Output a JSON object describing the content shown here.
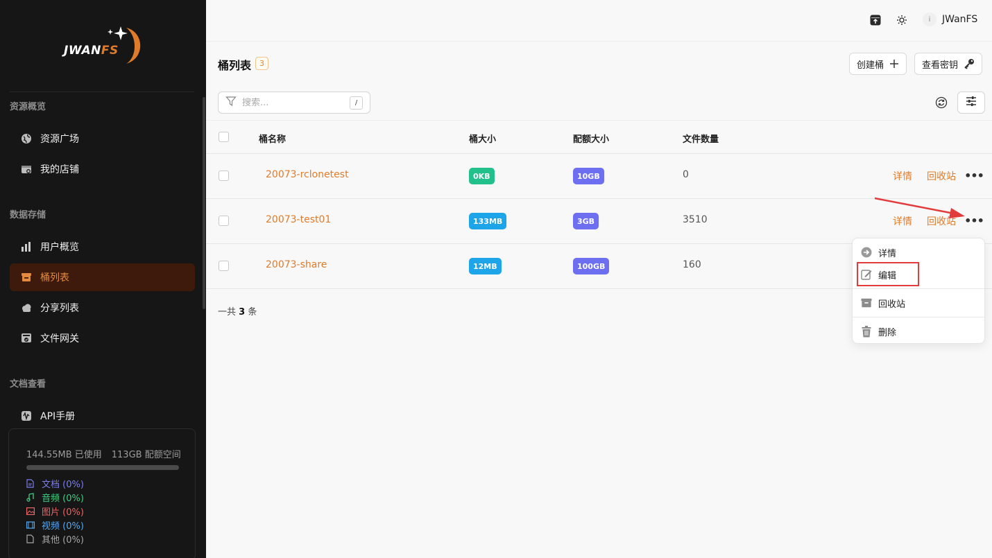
{
  "brand": {
    "logo_main": "JWAN",
    "logo_accent": "FS"
  },
  "sidebar": {
    "sections": [
      {
        "title": "资源概览",
        "items": [
          {
            "label": "资源广场",
            "icon": "globe-icon"
          },
          {
            "label": "我的店铺",
            "icon": "store-icon"
          }
        ]
      },
      {
        "title": "数据存储",
        "items": [
          {
            "label": "用户概览",
            "icon": "bar-chart-icon"
          },
          {
            "label": "桶列表",
            "icon": "bucket-icon",
            "active": true
          },
          {
            "label": "分享列表",
            "icon": "cloud-share-icon"
          },
          {
            "label": "文件网关",
            "icon": "gateway-icon"
          }
        ]
      },
      {
        "title": "文档查看",
        "items": [
          {
            "label": "API手册",
            "icon": "api-icon"
          }
        ]
      }
    ],
    "usage": {
      "used": "144.55MB 已使用",
      "quota": "113GB 配额空间",
      "legend": [
        {
          "label": "文档 (0%)",
          "color": "#7b7ff0",
          "icon": "document-icon"
        },
        {
          "label": "音频 (0%)",
          "color": "#3fcf86",
          "icon": "music-icon"
        },
        {
          "label": "图片 (0%)",
          "color": "#ec6464",
          "icon": "image-icon"
        },
        {
          "label": "视频 (0%)",
          "color": "#56a8ee",
          "icon": "video-icon"
        },
        {
          "label": "其他 (0%)",
          "color": "#a8a8a8",
          "icon": "file-icon"
        }
      ]
    }
  },
  "topbar": {
    "avatar_initial": "i",
    "username": "JWanFS"
  },
  "page": {
    "title": "桶列表",
    "count": "3",
    "create_button": "创建桶",
    "keys_button": "查看密钥",
    "search_placeholder": "搜索...",
    "search_shortcut": "/",
    "columns": [
      "桶名称",
      "桶大小",
      "配额大小",
      "文件数量"
    ],
    "rows": [
      {
        "name": "20073-rclonetest",
        "size": "0KB",
        "quota": "10GB",
        "files": "0",
        "show_actions": true
      },
      {
        "name": "20073-test01",
        "size": "133MB",
        "quota": "3GB",
        "files": "3510",
        "show_actions": true
      },
      {
        "name": "20073-share",
        "size": "12MB",
        "quota": "100GB",
        "files": "160",
        "show_actions": false
      }
    ],
    "action_detail": "详情",
    "action_recycle": "回收站",
    "total_prefix": "一共",
    "total_count": "3",
    "total_suffix": "条"
  },
  "context_menu": {
    "items": [
      {
        "label": "详情",
        "icon": "arrow-circle-right-icon"
      },
      {
        "label": "编辑",
        "icon": "edit-icon"
      },
      {
        "label": "回收站",
        "icon": "archive-icon"
      },
      {
        "label": "删除",
        "icon": "trash-icon"
      }
    ]
  },
  "colors": {
    "accent": "#e07b2a",
    "sidebar_bg": "#161616",
    "active_bg": "#3d1a0c",
    "annotation_red": "#e23b3b"
  }
}
